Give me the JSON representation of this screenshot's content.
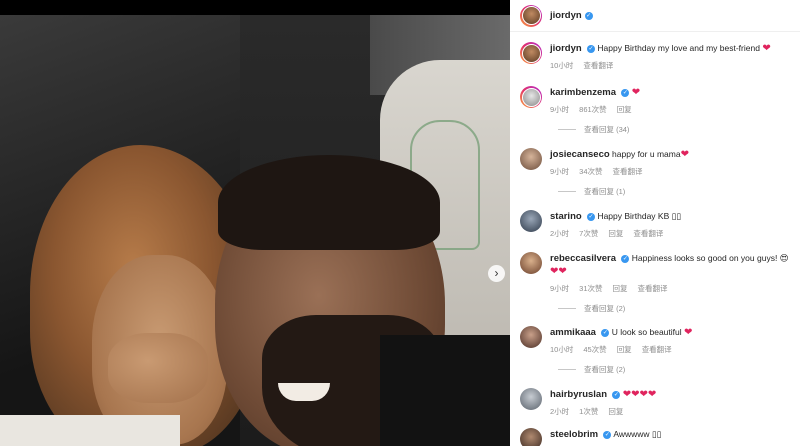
{
  "post": {
    "author": "jiordyn"
  },
  "caption": {
    "username": "jiordyn",
    "text": "Happy Birthday my love and my best-friend",
    "emoji": "❤",
    "time": "10小时",
    "translate": "查看翻译"
  },
  "comments": [
    {
      "username": "karimbenzema",
      "verified": true,
      "text": "",
      "emoji": "❤",
      "time": "9小时",
      "likes": "861次赞",
      "reply": "回复",
      "view_replies": "查看回复 (34)"
    },
    {
      "username": "josiecanseco",
      "verified": false,
      "text": "happy for u mama",
      "emoji": "❤",
      "time": "9小时",
      "likes": "34次赞",
      "translate": "查看翻译",
      "view_replies": "查看回复 (1)"
    },
    {
      "username": "starino",
      "verified": true,
      "text": "Happy Birthday KB",
      "emoji": "▯▯",
      "time": "2小时",
      "likes": "7次赞",
      "reply": "回复",
      "translate": "查看翻译"
    },
    {
      "username": "rebeccasilvera",
      "verified": true,
      "text": "Happiness looks so good on you guys!",
      "emoji": "😍",
      "emoji2": "❤❤",
      "time": "9小时",
      "likes": "31次赞",
      "reply": "回复",
      "translate": "查看翻译",
      "view_replies": "查看回复 (2)"
    },
    {
      "username": "ammikaaa",
      "verified": true,
      "text": "U look so beautiful",
      "emoji": "❤",
      "time": "10小时",
      "likes": "45次赞",
      "reply": "回复",
      "translate": "查看翻译",
      "view_replies": "查看回复 (2)"
    },
    {
      "username": "hairbyruslan",
      "verified": true,
      "text": "",
      "emoji": "❤❤❤❤",
      "time": "2小时",
      "likes": "1次赞",
      "reply": "回复"
    },
    {
      "username": "steelobrim",
      "verified": true,
      "text": "Awwwww",
      "emoji": "▯▯"
    }
  ],
  "icons": {
    "carousel_next": "chevron-right-icon",
    "verified": "verified-badge-icon"
  },
  "colors": {
    "heart": "#e0245e",
    "verified": "#3897f0"
  }
}
